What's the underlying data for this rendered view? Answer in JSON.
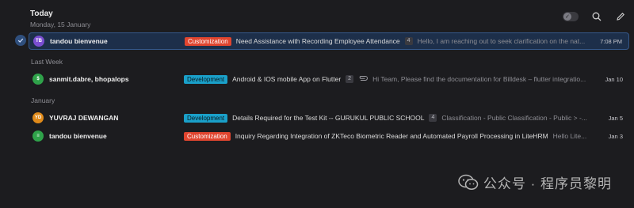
{
  "header": {
    "title": "Today",
    "subtitle": "Monday, 15 January"
  },
  "sections": {
    "last_week": "Last Week",
    "january": "January"
  },
  "rows": [
    {
      "avatar_text": "TB",
      "avatar_color": "#7a4ed1",
      "sender": "tandou bienvenue",
      "tag": "Customization",
      "subject": "Need Assistance with Recording Employee Attendance",
      "count": "4",
      "snippet": "Hello, I am reaching out to seek clarification on the nat...",
      "date": "7:08 PM"
    },
    {
      "avatar_text": "$",
      "avatar_color": "#2fa24a",
      "sender": "sanmit.dabre, bhopalops",
      "tag": "Development",
      "subject": "Android & IOS mobile App on Flutter",
      "count": "2",
      "snippet": "Hi Team, Please find the documentation for Billdesk – flutter integratio...",
      "date": "Jan 10"
    },
    {
      "avatar_text": "YD",
      "avatar_color": "#e08a1a",
      "sender": "YUVRAJ DEWANGAN",
      "tag": "Development",
      "subject": "Details Required for the Test Kit -- GURUKUL PUBLIC SCHOOL",
      "count": "4",
      "snippet": "Classification - Public Classification - Public > -...",
      "date": "Jan 5"
    },
    {
      "avatar_text": "≡",
      "avatar_color": "#2fa24a",
      "sender": "tandou bienvenue",
      "tag": "Customization",
      "subject": "Inquiry Regarding Integration of ZKTeco Biometric Reader and Automated Payroll Processing in LiteHRM",
      "count": "",
      "snippet": "Hello Lite...",
      "date": "Jan 3"
    }
  ],
  "watermark": {
    "text": "公众号 · 程序员黎明"
  },
  "colors": {
    "background": "#1c1c1f",
    "selected_row": "#1d2f4a",
    "customization_tag": "#e0452f",
    "development_tag": "#1aa0c9"
  }
}
